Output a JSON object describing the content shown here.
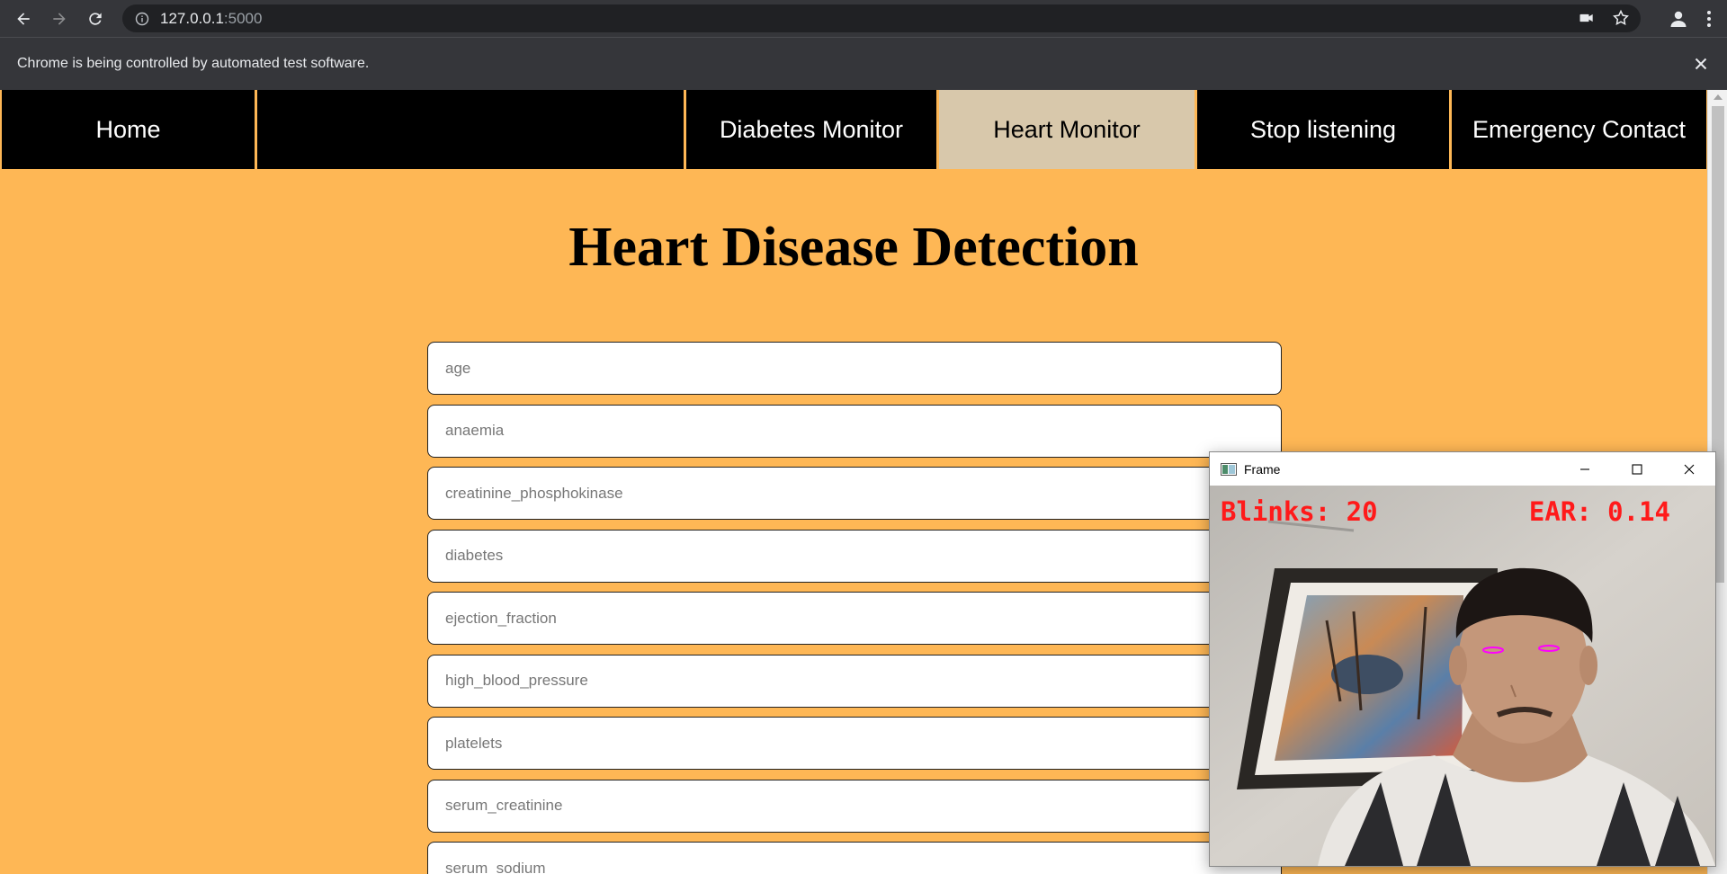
{
  "browser": {
    "url_host": "127.0.0.1",
    "url_port": ":5000",
    "infobar_message": "Chrome is being controlled by automated test software."
  },
  "nav": {
    "items": [
      {
        "label": "Home",
        "active": false
      },
      {
        "label": "",
        "active": false
      },
      {
        "label": "Diabetes Monitor",
        "active": false
      },
      {
        "label": "Heart Monitor",
        "active": true
      },
      {
        "label": "Stop listening",
        "active": false
      },
      {
        "label": "Emergency Contact",
        "active": false
      }
    ]
  },
  "page": {
    "title": "Heart Disease Detection"
  },
  "form": {
    "fields": [
      {
        "placeholder": "age"
      },
      {
        "placeholder": "anaemia"
      },
      {
        "placeholder": "creatinine_phosphokinase"
      },
      {
        "placeholder": "diabetes"
      },
      {
        "placeholder": "ejection_fraction"
      },
      {
        "placeholder": "high_blood_pressure"
      },
      {
        "placeholder": "platelets"
      },
      {
        "placeholder": "serum_creatinine"
      },
      {
        "placeholder": "serum_sodium"
      }
    ]
  },
  "frame_window": {
    "title": "Frame",
    "blinks_text": "Blinks: 20",
    "ear_text": "EAR: 0.14"
  },
  "colors": {
    "page_bg": "#feb755",
    "nav_bg": "#000000",
    "nav_active_bg": "#d8c8ab",
    "overlay_text": "#ff1a1a",
    "eye_contour": "#ff00ff"
  }
}
